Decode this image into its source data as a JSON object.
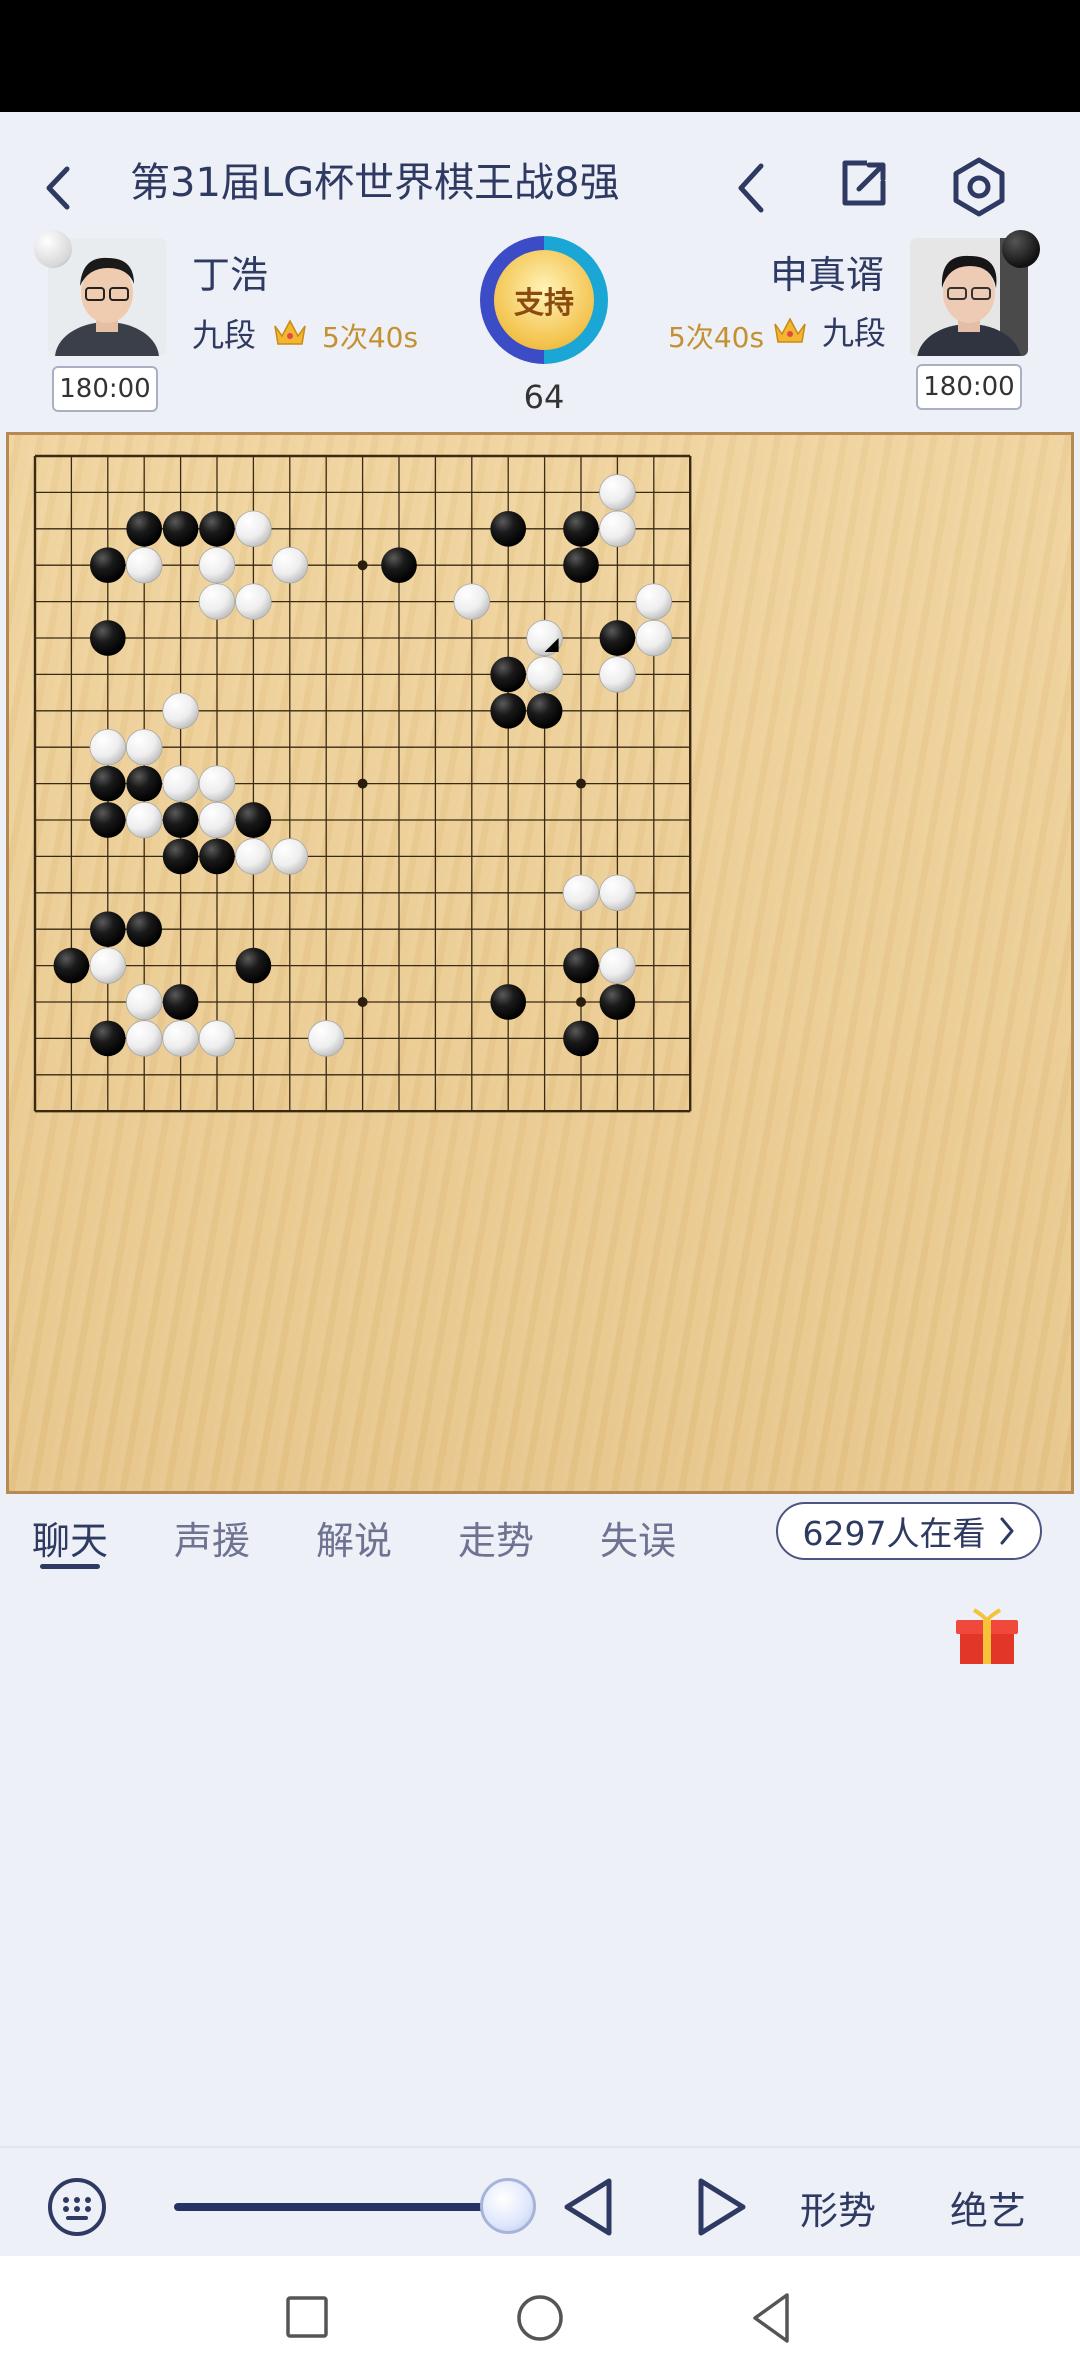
{
  "header": {
    "title": "第31届LG杯世界棋王战8强",
    "back_icon": "chevron-left-icon",
    "prev_icon": "chevron-left-icon",
    "share_icon": "share-icon",
    "settings_icon": "settings-icon"
  },
  "players": {
    "black": {
      "name": "丁浩",
      "rank": "九段",
      "byoyomi": "5次40s",
      "clock": "180:00"
    },
    "white": {
      "name": "申真谞",
      "rank": "九段",
      "byoyomi": "5次40s",
      "clock": "180:00"
    },
    "support_label": "支持",
    "move_number": "64"
  },
  "board": {
    "size": 19,
    "black_stones": [
      [
        3,
        2
      ],
      [
        4,
        2
      ],
      [
        5,
        2
      ],
      [
        13,
        2
      ],
      [
        15,
        2
      ],
      [
        2,
        3
      ],
      [
        10,
        3
      ],
      [
        15,
        3
      ],
      [
        2,
        5
      ],
      [
        16,
        5
      ],
      [
        13,
        6
      ],
      [
        13,
        7
      ],
      [
        14,
        7
      ],
      [
        2,
        9
      ],
      [
        3,
        9
      ],
      [
        2,
        10
      ],
      [
        4,
        10
      ],
      [
        6,
        10
      ],
      [
        4,
        11
      ],
      [
        5,
        11
      ],
      [
        2,
        13
      ],
      [
        3,
        13
      ],
      [
        1,
        14
      ],
      [
        6,
        14
      ],
      [
        15,
        14
      ],
      [
        4,
        15
      ],
      [
        13,
        15
      ],
      [
        16,
        15
      ],
      [
        2,
        16
      ],
      [
        15,
        16
      ]
    ],
    "white_stones": [
      [
        16,
        1
      ],
      [
        6,
        2
      ],
      [
        16,
        2
      ],
      [
        3,
        3
      ],
      [
        5,
        3
      ],
      [
        7,
        3
      ],
      [
        5,
        4
      ],
      [
        6,
        4
      ],
      [
        12,
        4
      ],
      [
        17,
        4
      ],
      [
        14,
        5
      ],
      [
        17,
        5
      ],
      [
        14,
        6
      ],
      [
        16,
        6
      ],
      [
        4,
        7
      ],
      [
        2,
        8
      ],
      [
        3,
        8
      ],
      [
        4,
        9
      ],
      [
        5,
        9
      ],
      [
        3,
        10
      ],
      [
        5,
        10
      ],
      [
        6,
        11
      ],
      [
        7,
        11
      ],
      [
        15,
        12
      ],
      [
        16,
        12
      ],
      [
        2,
        14
      ],
      [
        16,
        14
      ],
      [
        3,
        15
      ],
      [
        3,
        16
      ],
      [
        4,
        16
      ],
      [
        5,
        16
      ],
      [
        8,
        16
      ]
    ],
    "last_move": [
      14,
      5
    ],
    "star_points": [
      [
        9,
        3
      ],
      [
        9,
        9
      ],
      [
        15,
        9
      ],
      [
        9,
        15
      ],
      [
        15,
        15
      ]
    ]
  },
  "tabs": [
    {
      "label": "聊天",
      "active": true
    },
    {
      "label": "声援",
      "active": false
    },
    {
      "label": "解说",
      "active": false
    },
    {
      "label": "走势",
      "active": false
    },
    {
      "label": "失误",
      "active": false
    }
  ],
  "viewers": {
    "label": "6297人在看"
  },
  "bottom": {
    "keyboard_icon": "keyboard-icon",
    "prev_move_icon": "triangle-left-icon",
    "next_move_icon": "triangle-right-icon",
    "situation_label": "形势",
    "tesuji_label": "绝艺",
    "slider_value": 1.0
  },
  "accent": {
    "primary": "#2e3a62",
    "gold": "#c49132",
    "board": "#e9c98e"
  }
}
